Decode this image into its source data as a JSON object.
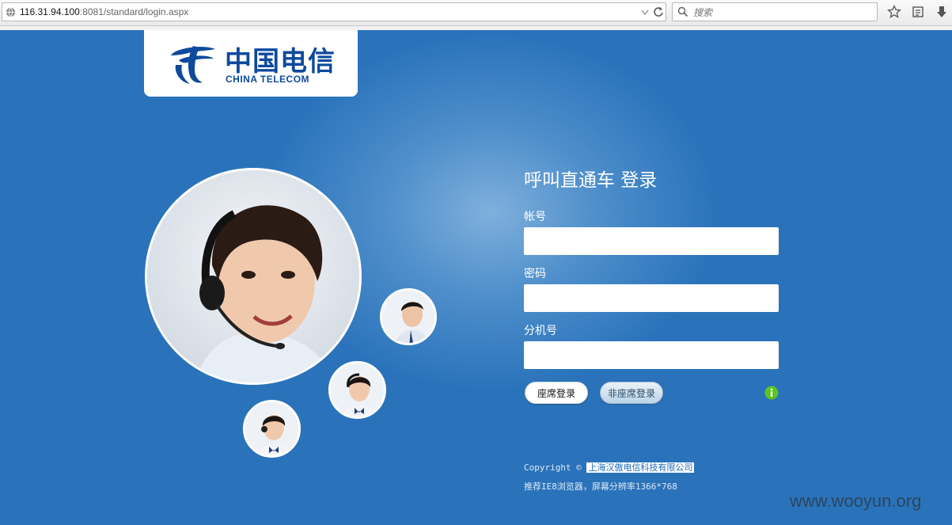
{
  "browser": {
    "url_host": "116.31.94.100",
    "url_rest": ":8081/standard/login.aspx",
    "search_placeholder": "搜索"
  },
  "logo": {
    "name_cn": "中国电信",
    "name_en": "CHINA TELECOM"
  },
  "login": {
    "title": "呼叫直通车 登录",
    "account_label": "帐号",
    "account_value": "",
    "password_label": "密码",
    "password_value": "",
    "extension_label": "分机号",
    "extension_value": "",
    "agent_login_button": "座席登录",
    "non_agent_login_button": "非座席登录"
  },
  "footer": {
    "copyright_prefix": "Copyright © ",
    "company": "上海汉傲电信科技有限公司",
    "recommend": "推荐IE8浏览器，屏幕分辨率1366*768"
  },
  "watermark": "www.wooyun.org",
  "colors": {
    "brand_blue": "#0d4a9c",
    "page_blue": "#2a73bb",
    "info_green": "#5cc421"
  }
}
